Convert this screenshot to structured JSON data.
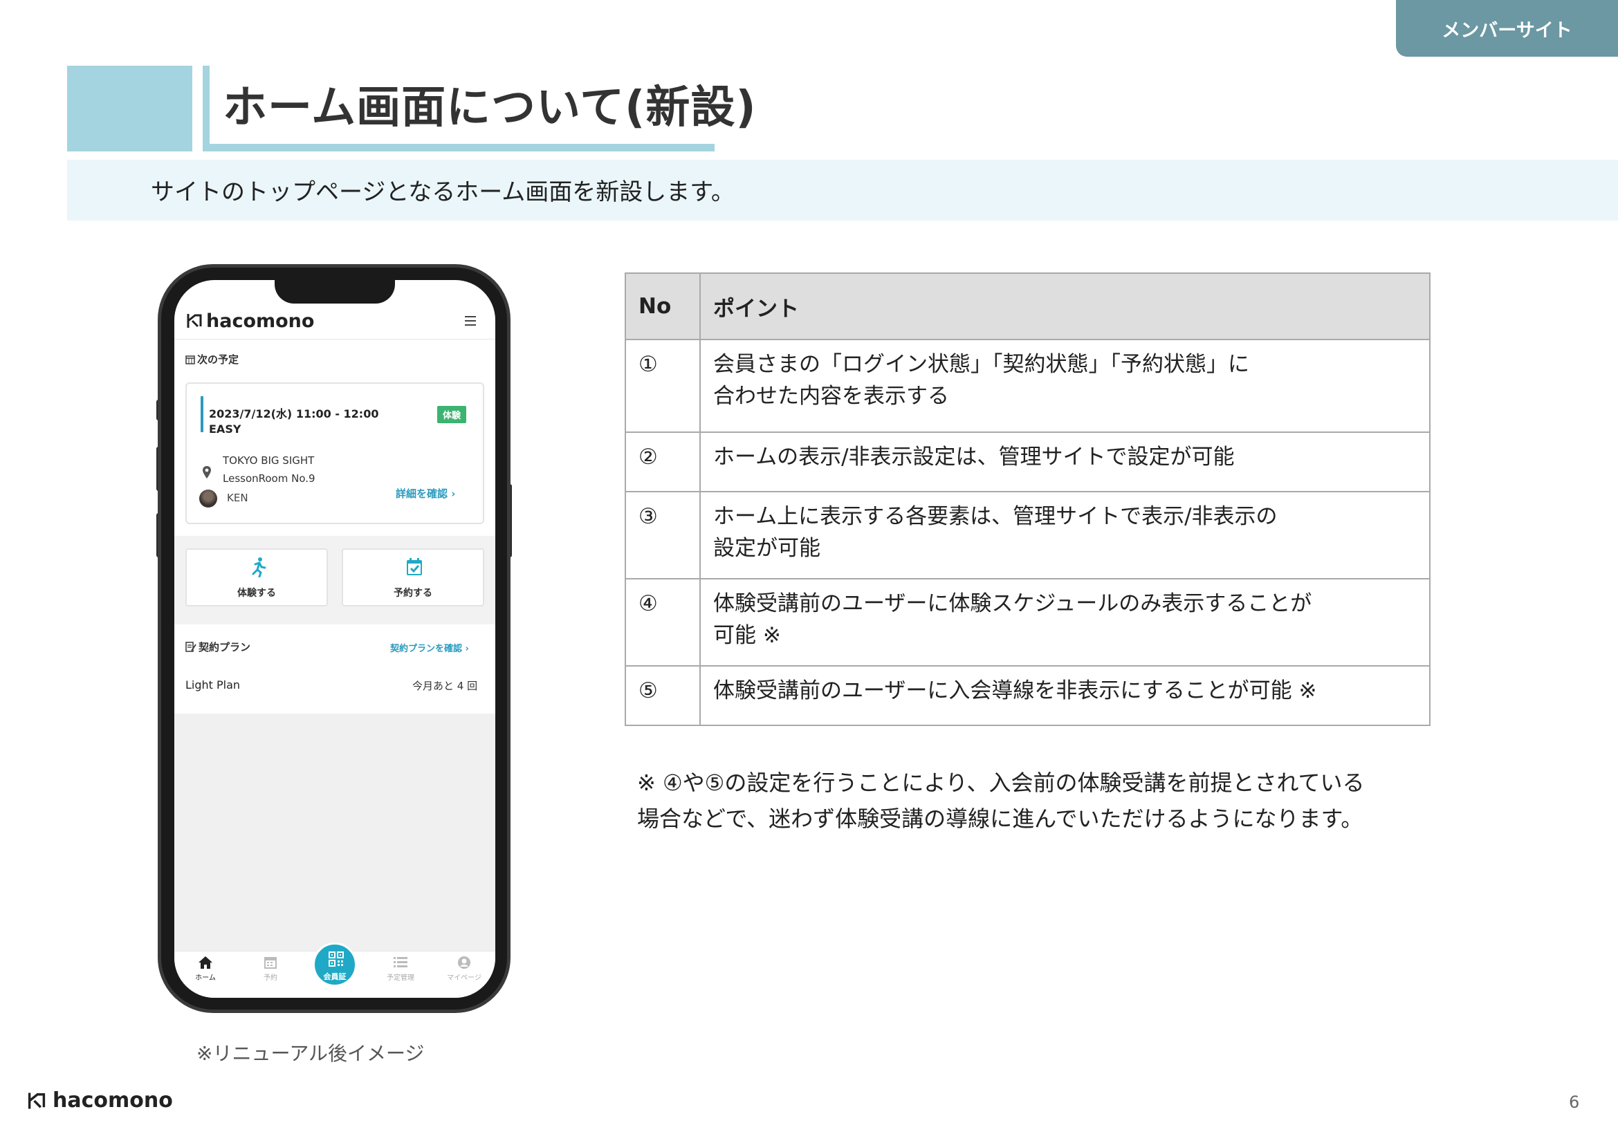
{
  "site_tag": "メンバーサイト",
  "title": "ホーム画面について(新設)",
  "subtitle": "サイトのトップページとなるホーム画面を新設します。",
  "phone": {
    "logo": "hacomono",
    "next_section": "次の予定",
    "lesson": {
      "date": "2023/7/12(水) 11:00 - 12:00",
      "name": "EASY",
      "badge": "体験",
      "venue": "TOKYO BIG SIGHT",
      "room": "LessonRoom No.9",
      "trainer": "KEN",
      "detail_link": "詳細を確認"
    },
    "quick_actions": [
      {
        "label": "体験する",
        "icon": "running-icon"
      },
      {
        "label": "予約する",
        "icon": "calendar-check-icon"
      }
    ],
    "plan_section": "契約プラン",
    "plan_link": "契約プランを確認",
    "plan_name": "Light Plan",
    "plan_remaining": "今月あと 4 回",
    "tabs": [
      {
        "label": "ホーム",
        "icon": "home-icon"
      },
      {
        "label": "予約",
        "icon": "calendar-icon"
      },
      {
        "label": "会員証",
        "icon": "qr-code-icon"
      },
      {
        "label": "予定管理",
        "icon": "list-icon"
      },
      {
        "label": "マイページ",
        "icon": "user-icon"
      }
    ]
  },
  "phone_caption": "※リニューアル後イメージ",
  "table": {
    "headers": [
      "No",
      "ポイント"
    ],
    "rows": [
      {
        "no": "①",
        "line1": "会員さまの「ログイン状態」「契約状態」「予約状態」に",
        "line2": "合わせた内容を表示する"
      },
      {
        "no": "②",
        "line1": "ホームの表示/非表示設定は、管理サイトで設定が可能",
        "line2": ""
      },
      {
        "no": "③",
        "line1": "ホーム上に表示する各要素は、管理サイトで表示/非表示の",
        "line2": "設定が可能"
      },
      {
        "no": "④",
        "line1": "体験受講前のユーザーに体験スケジュールのみ表示することが",
        "line2": "可能 ※"
      },
      {
        "no": "⑤",
        "line1": "体験受講前のユーザーに入会導線を非表示にすることが可能 ※",
        "line2": ""
      }
    ]
  },
  "note": {
    "line1": "※ ④や⑤の設定を行うことにより、入会前の体験受講を前提とされている",
    "line2": "場合などで、迷わず体験受講の導線に進んでいただけるようになります。"
  },
  "footer": {
    "logo": "hacomono",
    "page_number": "6"
  },
  "colors": {
    "accent": "#a4d4df",
    "tag": "#6b98a2",
    "brand": "#20a9c6",
    "badge": "#3cb371"
  }
}
